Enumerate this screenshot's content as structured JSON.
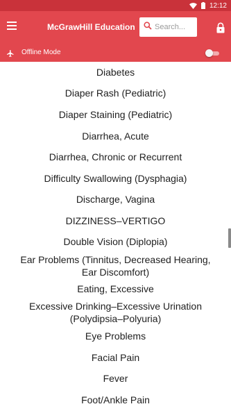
{
  "status_bar": {
    "time": "12:12",
    "icons": [
      "wifi-icon",
      "battery-icon"
    ]
  },
  "header": {
    "menu_icon": "hamburger-menu-icon",
    "brand": "McGrawHill Education",
    "search": {
      "placeholder": "Search...",
      "value": "",
      "icon": "search-icon"
    },
    "lock_icon": "lock-icon",
    "color": "#e2474e",
    "status_color": "#c9323a"
  },
  "offline_bar": {
    "icon": "airplane-icon",
    "label": "Offline Mode",
    "toggle_on": false
  },
  "topics": [
    "Diabetes",
    "Diaper Rash (Pediatric)",
    "Diaper Staining (Pediatric)",
    "Diarrhea, Acute",
    "Diarrhea, Chronic or Recurrent",
    "Difficulty Swallowing (Dysphagia)",
    "Discharge, Vagina",
    "DIZZINESS–VERTIGO",
    "Double Vision (Diplopia)",
    "Ear Problems (Tinnitus, Decreased Hearing, Ear Discomfort)",
    "Eating, Excessive",
    "Excessive Drinking–Excessive Urination (Polydipsia–Polyuria)",
    "Eye Problems",
    "Facial Pain",
    "Fever",
    "Foot/Ankle Pain"
  ]
}
